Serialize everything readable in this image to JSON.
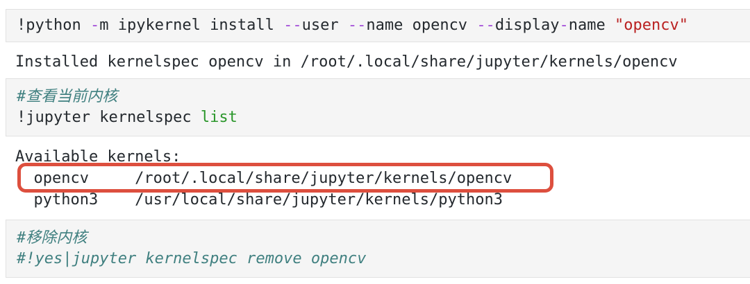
{
  "colors": {
    "cell_background": "#f5f5f5",
    "cell_border": "#e1e1e1",
    "code_foreground": "#24292e",
    "flag_dash_purple": "#a44fd9",
    "string_red": "#ba2121",
    "builtin_green": "#2a962a",
    "comment_teal": "#408080",
    "annotation_ring_red": "#dd4f3e"
  },
  "code_cell_1": {
    "full_text": "!python -m ipykernel install --user --name opencv --display-name \"opencv\"",
    "segs": [
      "!python ",
      "-",
      "m ipykernel install ",
      "--",
      "user ",
      "--",
      "name opencv ",
      "--",
      "display",
      "-",
      "name ",
      "\"opencv\""
    ]
  },
  "output_1": {
    "text": "Installed kernelspec opencv in /root/.local/share/jupyter/kernels/opencv"
  },
  "code_cell_2": {
    "comment": "#查看当前内核",
    "command_segs": [
      "!jupyter kernelspec ",
      "list"
    ]
  },
  "output_2": {
    "lines": [
      "Available kernels:",
      "  opencv     /root/.local/share/jupyter/kernels/opencv",
      "  python3    /usr/local/share/jupyter/kernels/python3"
    ],
    "annotation": "red rounded rectangle highlighting the opencv kernel row"
  },
  "code_cell_3": {
    "comments": [
      "#移除内核",
      "#!yes|jupyter kernelspec remove opencv"
    ]
  }
}
